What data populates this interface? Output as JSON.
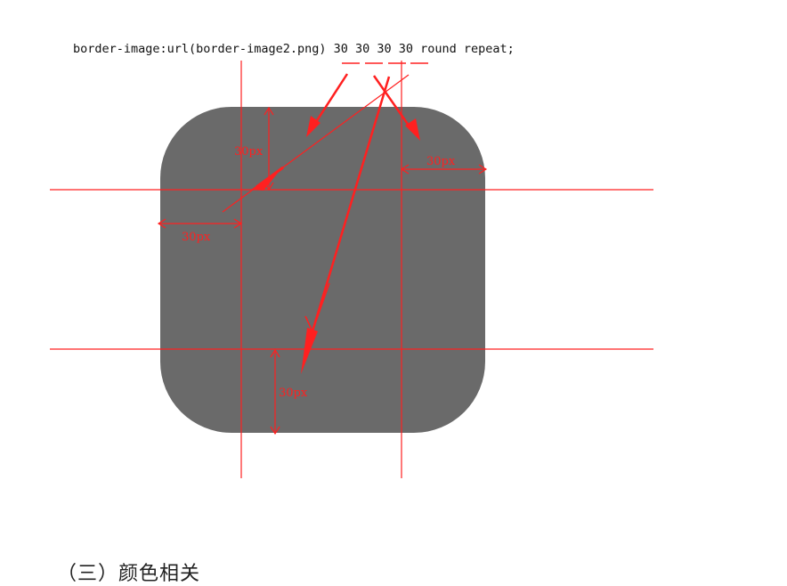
{
  "code_line": "border-image:url(border-image2.png) 30 30 30 30 round repeat;",
  "labels": {
    "top_slice": "30px",
    "right_slice": "30px",
    "left_slice": "30px",
    "bottom_slice": "30px"
  },
  "heading": "（三）颜色相关",
  "colors": {
    "box_fill": "#6a6a6a",
    "annotation": "#ff2020"
  }
}
